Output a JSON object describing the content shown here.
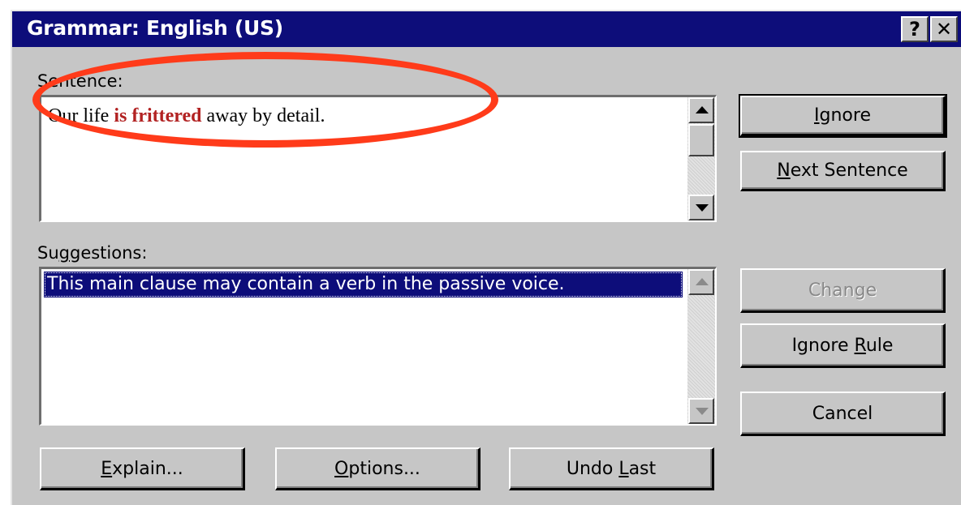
{
  "window": {
    "title": "Grammar: English (US)",
    "help_glyph": "?",
    "close_glyph": "✕"
  },
  "sentence": {
    "label": "Sentence:",
    "text_before": "Our life ",
    "text_highlight": "is frittered",
    "text_after": " away by detail."
  },
  "suggestions": {
    "label_pre": "Su",
    "label_accel": "g",
    "label_post": "gestions:",
    "items": [
      "This main clause may contain a verb in the passive voice."
    ]
  },
  "buttons": {
    "ignore": {
      "accel": "I",
      "rest": "gnore"
    },
    "next_sentence": {
      "accel": "N",
      "rest": "ext Sentence"
    },
    "change": {
      "label": "Change"
    },
    "ignore_rule": {
      "pre": "Ignore ",
      "accel": "R",
      "rest": "ule"
    },
    "cancel": {
      "label": "Cancel"
    },
    "explain": {
      "accel": "E",
      "rest": "xplain..."
    },
    "options": {
      "accel": "O",
      "rest": "ptions..."
    },
    "undo_last": {
      "pre": "Undo ",
      "accel": "L",
      "rest": "ast"
    }
  },
  "colors": {
    "titlebar": "#0d0d7a",
    "highlight_text": "#b22222",
    "annotation": "#ff3b1a"
  }
}
